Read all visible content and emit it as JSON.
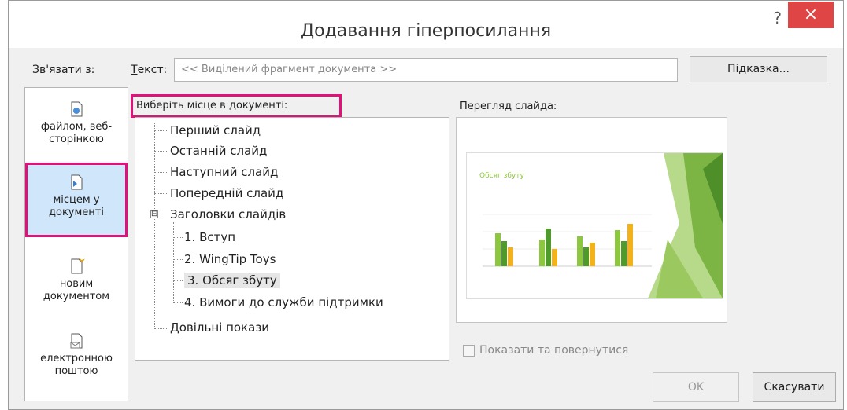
{
  "window": {
    "title": "Додавання гіперпосилання",
    "help_label": "?",
    "close_label": "×"
  },
  "link_to": {
    "label": "Зв'язати з:"
  },
  "text_field": {
    "label_prefix": "Т",
    "label_rest": "екст:",
    "value": "<< Виділений фрагмент документа >>"
  },
  "hint_button": {
    "label": "Підказка..."
  },
  "sidebar": {
    "items": [
      {
        "label": "файлом, веб-сторінкою",
        "icon": "file-web-icon"
      },
      {
        "label": "місцем у документі",
        "icon": "place-in-document-icon",
        "selected": true
      },
      {
        "label": "новим документом",
        "icon": "new-document-icon"
      },
      {
        "label": "електронною поштою",
        "icon": "email-icon"
      }
    ]
  },
  "place_section": {
    "label": "Виберіть місце в документі:"
  },
  "tree": {
    "items": [
      {
        "label": "Перший слайд"
      },
      {
        "label": "Останній слайд"
      },
      {
        "label": "Наступний слайд"
      },
      {
        "label": "Попередній слайд"
      },
      {
        "label": "Заголовки слайдів",
        "expander": "⊟"
      },
      {
        "label": "1. Вступ"
      },
      {
        "label": "2. WingTip Toys"
      },
      {
        "label": "3. Обсяг збуту",
        "selected": true
      },
      {
        "label": "4. Вимоги до служби підтримки"
      },
      {
        "label": "Довільні покази"
      }
    ]
  },
  "preview": {
    "label": "Перегляд слайда:",
    "slide_title": "Обсяг збуту",
    "accent": "#8dc63f"
  },
  "show_return": {
    "label": "Показати та повернутися",
    "checked": false
  },
  "buttons": {
    "ok": "OK",
    "cancel": "Скасувати"
  }
}
